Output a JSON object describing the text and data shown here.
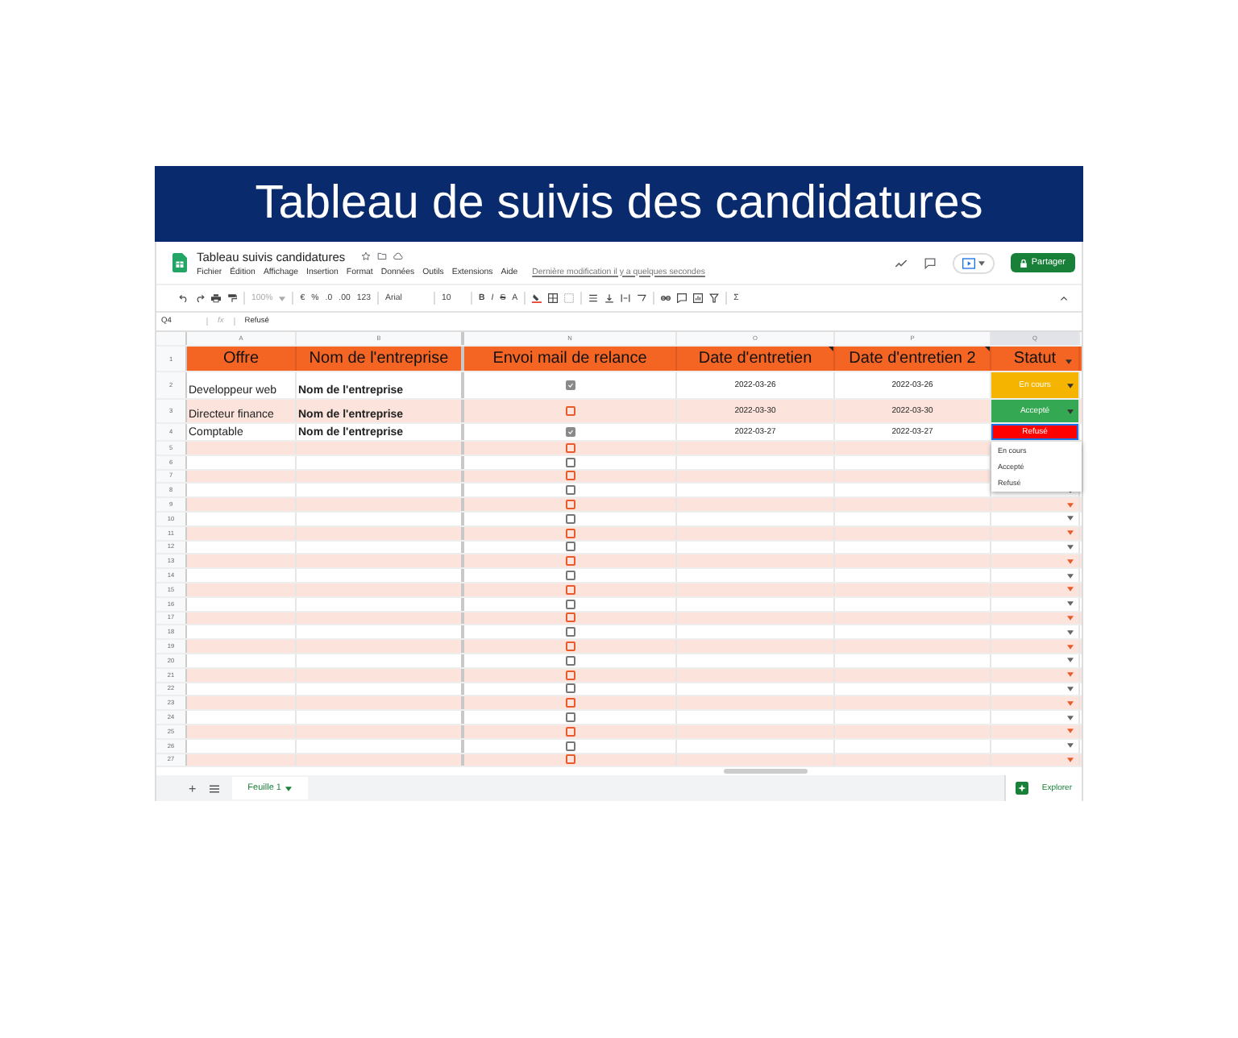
{
  "banner": {
    "title": "Tableau de suivis des candidatures"
  },
  "document": {
    "title": "Tableau suivis candidatures",
    "menu": [
      "Fichier",
      "Édition",
      "Affichage",
      "Insertion",
      "Format",
      "Données",
      "Outils",
      "Extensions",
      "Aide"
    ],
    "last_edit": "Dernière modification il y a quelques secondes",
    "share_button": "Partager"
  },
  "toolbar": {
    "zoom": "100%",
    "currency": "€",
    "percent": "%",
    "decrease_decimals": ".0",
    "increase_decimals": ".00",
    "number_format": "123",
    "font": "Arial",
    "font_size": "10",
    "bold": "B",
    "italic": "I",
    "strikethrough": "S",
    "text_color": "A",
    "functions": "Σ"
  },
  "formula_bar": {
    "cell": "Q4",
    "fx": "fx",
    "value": "Refusé"
  },
  "columns": [
    {
      "letter": "A",
      "header": "Offre"
    },
    {
      "letter": "B",
      "header": "Nom de l'entreprise"
    },
    {
      "letter": "N",
      "header": "Envoi mail de relance"
    },
    {
      "letter": "O",
      "header": "Date d'entretien"
    },
    {
      "letter": "P",
      "header": "Date d'entretien 2"
    },
    {
      "letter": "Q",
      "header": "Statut"
    }
  ],
  "header_row_number": "1",
  "rows": [
    {
      "number": "2",
      "offre": "Developpeur web",
      "entreprise": "Nom de l'entreprise",
      "checked": true,
      "date1": "2022-03-26",
      "date2": "2022-03-26",
      "status": {
        "label": "En cours",
        "color": "#f4b400",
        "selected": false
      }
    },
    {
      "number": "3",
      "offre": "Directeur finance",
      "entreprise": "Nom de l'entreprise",
      "checked": false,
      "date1": "2022-03-30",
      "date2": "2022-03-30",
      "status": {
        "label": "Accepté",
        "color": "#34a853",
        "selected": false
      }
    },
    {
      "number": "4",
      "offre": "Comptable",
      "entreprise": "Nom de l'entreprise",
      "checked": true,
      "date1": "2022-03-27",
      "date2": "2022-03-27",
      "status": {
        "label": "Refusé",
        "color": "#ff0000",
        "selected": true
      }
    },
    {
      "number": "5",
      "checked": false
    },
    {
      "number": "6",
      "checked": false
    },
    {
      "number": "7",
      "checked": false
    },
    {
      "number": "8",
      "checked": false
    },
    {
      "number": "9",
      "checked": false
    },
    {
      "number": "10",
      "checked": false
    },
    {
      "number": "11",
      "checked": false
    },
    {
      "number": "12",
      "checked": false
    },
    {
      "number": "13",
      "checked": false
    },
    {
      "number": "14",
      "checked": false
    },
    {
      "number": "15",
      "checked": false
    },
    {
      "number": "16",
      "checked": false
    },
    {
      "number": "17",
      "checked": false
    },
    {
      "number": "18",
      "checked": false
    },
    {
      "number": "19",
      "checked": false
    },
    {
      "number": "20",
      "checked": false
    },
    {
      "number": "21",
      "checked": false
    },
    {
      "number": "22",
      "checked": false
    },
    {
      "number": "23",
      "checked": false
    },
    {
      "number": "24",
      "checked": false
    },
    {
      "number": "25",
      "checked": false
    },
    {
      "number": "26",
      "checked": false
    },
    {
      "number": "27",
      "checked": false
    }
  ],
  "status_menu": [
    "En cours",
    "Accepté",
    "Refusé"
  ],
  "sheet_tabs": [
    {
      "label": "Feuille 1",
      "selected": true
    }
  ],
  "add_sheet": "+",
  "explore_button": "Explorer"
}
